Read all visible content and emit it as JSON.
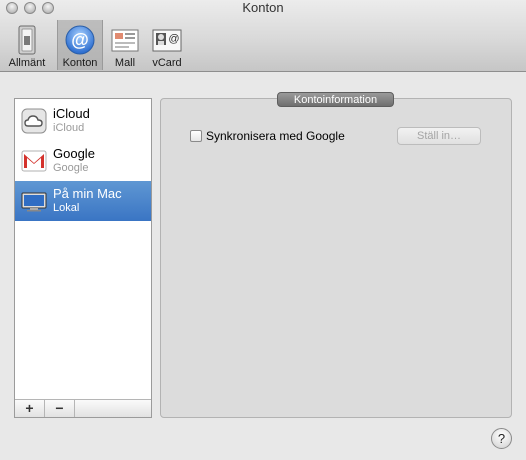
{
  "window": {
    "title": "Konton"
  },
  "toolbar": {
    "items": [
      {
        "label": "Allmänt",
        "icon": "general-switch-icon"
      },
      {
        "label": "Konton",
        "icon": "at-sign-icon",
        "selected": true
      },
      {
        "label": "Mall",
        "icon": "template-card-icon"
      },
      {
        "label": "vCard",
        "icon": "vcard-icon"
      }
    ]
  },
  "accounts": [
    {
      "name": "iCloud",
      "type": "iCloud",
      "icon": "icloud-icon"
    },
    {
      "name": "Google",
      "type": "Google",
      "icon": "gmail-icon"
    },
    {
      "name": "På min Mac",
      "type": "Lokal",
      "icon": "mac-computer-icon",
      "selected": true
    }
  ],
  "list_footer": {
    "add": "+",
    "remove": "−"
  },
  "info": {
    "section_title": "Kontoinformation",
    "sync_label": "Synkronisera med Google",
    "sync_checked": false,
    "setup_button": "Ställ in…"
  },
  "help": {
    "label": "?"
  },
  "colors": {
    "selection": "#3a75c4",
    "accent_blue": "#4a8fe3"
  }
}
